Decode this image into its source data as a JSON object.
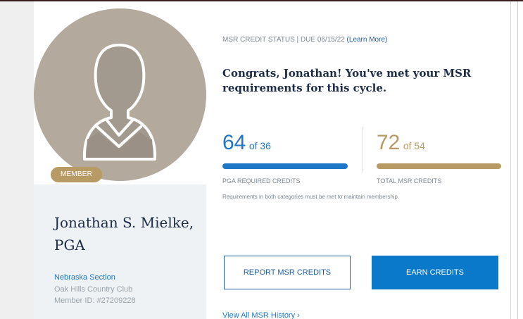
{
  "profile": {
    "badge": "MEMBER",
    "name": "Jonathan S. Mielke, PGA",
    "section": "Nebraska Section",
    "club": "Oak Hills Country Club",
    "member_id": "Member ID: #27209228"
  },
  "status": {
    "label": "MSR CREDIT STATUS | DUE 06/15/22",
    "learn_more": "(Learn More)",
    "message": "Congrats, Jonathan! You've met your MSR requirements for this cycle."
  },
  "credits": {
    "pga": {
      "value": "64",
      "of": "of 36",
      "caption": "PGA REQUIRED CREDITS",
      "progress": 1.0
    },
    "total": {
      "value": "72",
      "of": "of 54",
      "caption": "TOTAL MSR CREDITS",
      "progress": 1.0
    },
    "note": "Requirements in both categories must be met to maintain membership."
  },
  "actions": {
    "report": "REPORT MSR CREDITS",
    "earn": "EARN CREDITS",
    "history": "View All MSR History ›"
  },
  "icons": {
    "avatar": "person-silhouette-icon"
  },
  "colors": {
    "primary_blue": "#1f77c7",
    "gold": "#b79a64",
    "navy_text": "#1d2c48",
    "avatar_bg": "#b3a99d"
  }
}
